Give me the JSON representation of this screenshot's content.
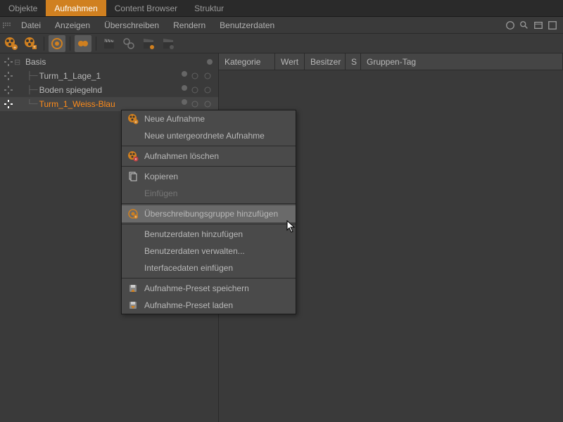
{
  "tabs": [
    "Objekte",
    "Aufnahmen",
    "Content Browser",
    "Struktur"
  ],
  "active_tab": 1,
  "menu": [
    "Datei",
    "Anzeigen",
    "Überschreiben",
    "Rendern",
    "Benutzerdaten"
  ],
  "tree": {
    "root": "Basis",
    "items": [
      "Turm_1_Lage_1",
      "Boden spiegelnd",
      "Turm_1_Weiss-Blau"
    ],
    "selected": 2
  },
  "table_headers": [
    "Kategorie",
    "Wert",
    "Besitzer",
    "S",
    "Gruppen-Tag"
  ],
  "context_menu": {
    "groups": [
      [
        {
          "label": "Neue Aufnahme",
          "icon": "film-plus"
        },
        {
          "label": "Neue untergeordnete Aufnahme",
          "icon": ""
        }
      ],
      [
        {
          "label": "Aufnahmen löschen",
          "icon": "film-x"
        }
      ],
      [
        {
          "label": "Kopieren",
          "icon": "copy"
        },
        {
          "label": "Einfügen",
          "icon": "",
          "disabled": true
        }
      ],
      [
        {
          "label": "Überschreibungsgruppe hinzufügen",
          "icon": "override",
          "highlighted": true
        }
      ],
      [
        {
          "label": "Benutzerdaten hinzufügen",
          "icon": ""
        },
        {
          "label": "Benutzerdaten verwalten...",
          "icon": ""
        },
        {
          "label": "Interfacedaten einfügen",
          "icon": ""
        }
      ],
      [
        {
          "label": "Aufnahme-Preset speichern",
          "icon": "preset-save"
        },
        {
          "label": "Aufnahme-Preset laden",
          "icon": "preset-load"
        }
      ]
    ]
  }
}
